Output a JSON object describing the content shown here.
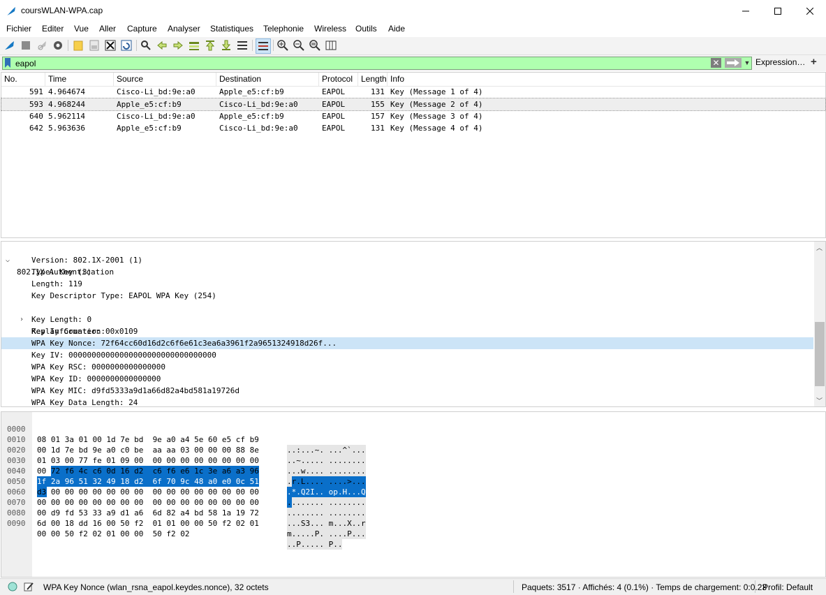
{
  "window": {
    "title": "coursWLAN-WPA.cap"
  },
  "menu": [
    "Fichier",
    "Editer",
    "Vue",
    "Aller",
    "Capture",
    "Analyser",
    "Statistiques",
    "Telephonie",
    "Wireless",
    "Outils",
    "Aide"
  ],
  "filter": {
    "value": "eapol",
    "expression_label": "Expression…",
    "add_label": "+"
  },
  "packet_list": {
    "columns": [
      "No.",
      "Time",
      "Source",
      "Destination",
      "Protocol",
      "Length",
      "Info"
    ],
    "rows": [
      {
        "no": "591",
        "time": "4.964674",
        "source": "Cisco-Li_bd:9e:a0",
        "destination": "Apple_e5:cf:b9",
        "protocol": "EAPOL",
        "length": "131",
        "info": "Key (Message 1 of 4)"
      },
      {
        "no": "593",
        "time": "4.968244",
        "source": "Apple_e5:cf:b9",
        "destination": "Cisco-Li_bd:9e:a0",
        "protocol": "EAPOL",
        "length": "155",
        "info": "Key (Message 2 of 4)"
      },
      {
        "no": "640",
        "time": "5.962114",
        "source": "Cisco-Li_bd:9e:a0",
        "destination": "Apple_e5:cf:b9",
        "protocol": "EAPOL",
        "length": "157",
        "info": "Key (Message 3 of 4)"
      },
      {
        "no": "642",
        "time": "5.963636",
        "source": "Apple_e5:cf:b9",
        "destination": "Cisco-Li_bd:9e:a0",
        "protocol": "EAPOL",
        "length": "131",
        "info": "Key (Message 4 of 4)"
      }
    ]
  },
  "details": {
    "root": "802.1X Authentication",
    "lines": [
      "Version: 802.1X-2001 (1)",
      "Type: Key (3)",
      "Length: 119",
      "Key Descriptor Type: EAPOL WPA Key (254)",
      "Key Information: 0x0109",
      "Key Length: 0",
      "Replay Counter: 0",
      "WPA Key Nonce: 72f64cc60d16d2c6f6e61c3ea6a3961f2a9651324918d26f...",
      "Key IV: 00000000000000000000000000000000",
      "WPA Key RSC: 0000000000000000",
      "WPA Key ID: 0000000000000000",
      "WPA Key MIC: d9fd5333a9d1a66d82a4bd581a19726d",
      "WPA Key Data Length: 24"
    ]
  },
  "hex": {
    "offsets": [
      "0000",
      "0010",
      "0020",
      "0030",
      "0040",
      "0050",
      "0060",
      "0070",
      "0080",
      "0090"
    ],
    "bytes": [
      "08 01 3a 01 00 1d 7e bd  9e a0 a4 5e 60 e5 cf b9",
      "00 1d 7e bd 9e a0 c0 be  aa aa 03 00 00 00 88 8e",
      "01 03 00 77 fe 01 09 00  00 00 00 00 00 00 00 00",
      "00 72 f6 4c c6 0d 16 d2  c6 f6 e6 1c 3e a6 a3 96",
      "1f 2a 96 51 32 49 18 d2  6f 70 9c 48 a0 e0 0c 51",
      "d3 00 00 00 00 00 00 00  00 00 00 00 00 00 00 00",
      "00 00 00 00 00 00 00 00  00 00 00 00 00 00 00 00",
      "00 d9 fd 53 33 a9 d1 a6  6d 82 a4 bd 58 1a 19 72",
      "6d 00 18 dd 16 00 50 f2  01 01 00 00 50 f2 02 01",
      "00 00 50 f2 02 01 00 00  50 f2 02"
    ],
    "ascii": [
      "..:...~. ...^`...",
      "..~..... ........",
      "...w.... ........",
      ".r.L.... ....>...",
      ".*.Q2I.. op.H...Q",
      "........ ........",
      "........ ........",
      "...S3... m...X..r",
      "m.....P. ....P...",
      "..P..... P.."
    ]
  },
  "status": {
    "field": "WPA Key Nonce (wlan_rsna_eapol.keydes.nonce), 32 octets",
    "packets": "Paquets: 3517 · Affichés: 4 (0.1%) · Temps de chargement: 0:0.23",
    "profile": "Profil: Default"
  },
  "colors": {
    "filter_valid": "#afffaf",
    "selection": "#0a6fc9",
    "detail_selection": "#cce4f7"
  }
}
